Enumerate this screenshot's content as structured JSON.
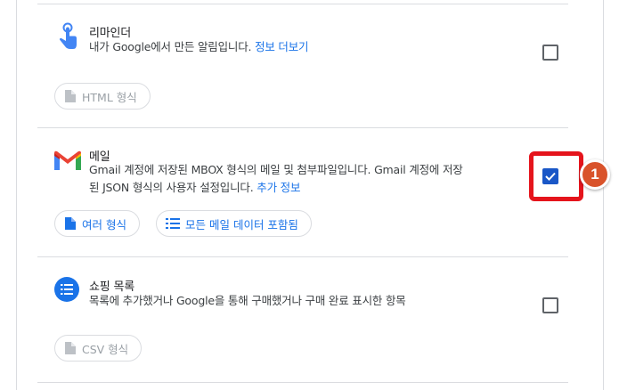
{
  "reminder": {
    "title": "리마인더",
    "description": "내가 Google에서 만든 알림입니다.",
    "more_link": "정보 더보기",
    "format_chip": "HTML 형식",
    "checked": false
  },
  "mail": {
    "title": "메일",
    "description_line1": "Gmail 계정에 저장된 MBOX 형식의 메일 및 첨부파일입니다. Gmail 계정에 저장",
    "description_line2": "된 JSON 형식의 사용자 설정입니다.",
    "more_link": "추가 정보",
    "format_chip": "여러 형식",
    "data_chip": "모든 메일 데이터 포함됨",
    "checked": true
  },
  "shopping": {
    "title": "쇼핑 목록",
    "description": "목록에 추가했거나 Google을 통해 구매했거나 구매 완료 표시한 항목",
    "format_chip": "CSV 형식",
    "checked": false
  },
  "annotation": {
    "badge_number": "1",
    "highlight_color": "#e5141c",
    "badge_color": "#d9532b"
  },
  "colors": {
    "link": "#1a73e8",
    "checkbox_checked": "#1a57c7"
  }
}
